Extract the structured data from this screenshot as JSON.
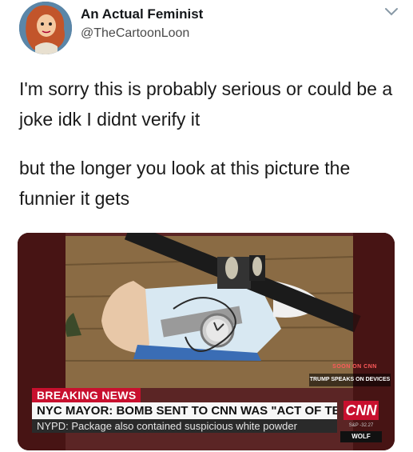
{
  "tweet": {
    "author_name": "An Actual Feminist",
    "handle": "@TheCartoonLoon",
    "text_line1": "I'm sorry this is probably serious or could be a joke idk I didnt verify it",
    "text_line2": "but the longer you look at this picture the funnier it gets"
  },
  "media": {
    "soon_label": "SOON ON CNN",
    "up_next": "TRUMP SPEAKS ON DEVICES",
    "breaking_label": "BREAKING NEWS",
    "headline": "NYC MAYOR: BOMB SENT TO CNN WAS \"ACT OF TERROR\"",
    "subline": "NYPD: Package also contained suspicious white powder",
    "network_logo": "CNN",
    "ticker": "S&P -32.27",
    "show_name": "WOLF"
  },
  "colors": {
    "cnn_red": "#c8102e",
    "text": "#14171a",
    "secondary_text": "#4a4a4a"
  },
  "icons": [
    "avatar-cartoon",
    "chevron-down-icon"
  ]
}
